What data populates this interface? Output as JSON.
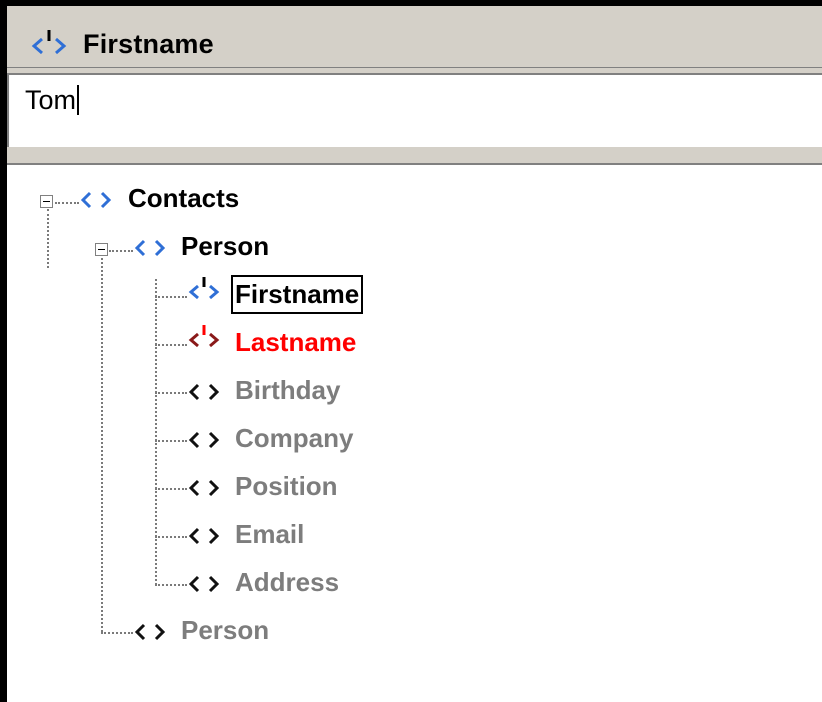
{
  "header": {
    "title": "Firstname",
    "icon": "element-attribute-icon"
  },
  "editor": {
    "value": "Tom"
  },
  "colors": {
    "active": "#000000",
    "error": "#ff0000",
    "inactive": "#7d7d7d",
    "icon_blue": "#2f6fd6"
  },
  "tree": {
    "root": {
      "label": "Contacts",
      "icon": "element-icon"
    },
    "person1": {
      "label": "Person",
      "icon": "element-icon"
    },
    "children": [
      {
        "label": "Firstname",
        "icon": "element-attribute-icon",
        "state": "selected"
      },
      {
        "label": "Lastname",
        "icon": "element-error-icon",
        "state": "error"
      },
      {
        "label": "Birthday",
        "icon": "element-icon",
        "state": "inactive"
      },
      {
        "label": "Company",
        "icon": "element-icon",
        "state": "inactive"
      },
      {
        "label": "Position",
        "icon": "element-icon",
        "state": "inactive"
      },
      {
        "label": "Email",
        "icon": "element-icon",
        "state": "inactive"
      },
      {
        "label": "Address",
        "icon": "element-icon",
        "state": "inactive"
      }
    ],
    "person2": {
      "label": "Person",
      "icon": "element-icon",
      "state": "inactive"
    }
  }
}
